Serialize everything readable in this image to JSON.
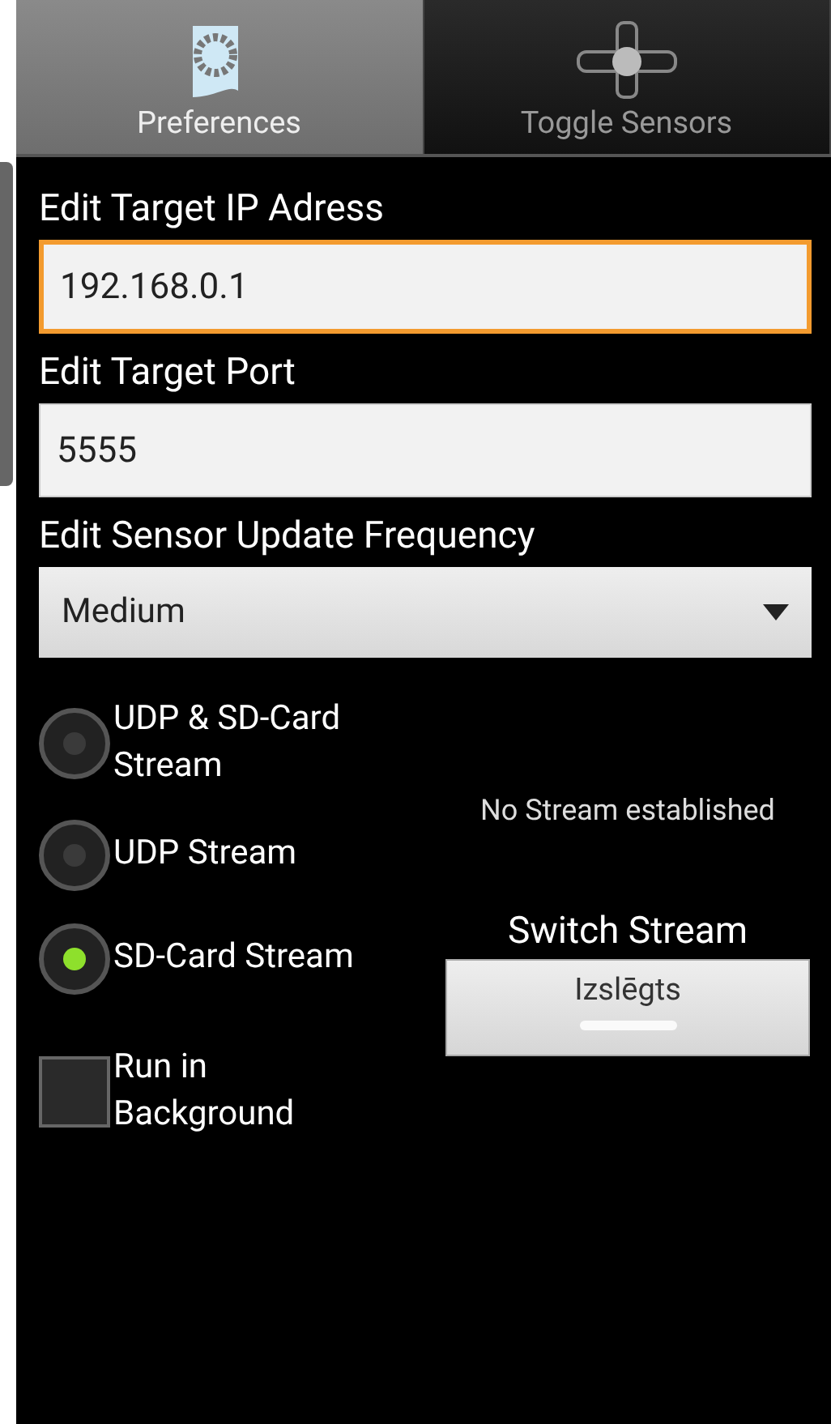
{
  "tabs": [
    {
      "label": "Preferences",
      "selected": true
    },
    {
      "label": "Toggle Sensors",
      "selected": false
    }
  ],
  "fields": [
    {
      "label": "Edit Target IP Adress",
      "value": "192.168.0.1",
      "focused": true
    },
    {
      "label": "Edit Target Port",
      "value": "5555",
      "focused": false
    }
  ],
  "frequency": {
    "label": "Edit Sensor Update Frequency",
    "value": "Medium"
  },
  "streams": [
    {
      "label": "UDP & SD-Card Stream",
      "selected": false
    },
    {
      "label": "UDP Stream",
      "selected": false
    },
    {
      "label": "SD-Card Stream",
      "selected": true
    }
  ],
  "background": {
    "label": "Run in Background",
    "checked": false
  },
  "status": "No Stream established",
  "switch": {
    "label": "Switch Stream",
    "text": "Izslēgts",
    "on": false
  }
}
